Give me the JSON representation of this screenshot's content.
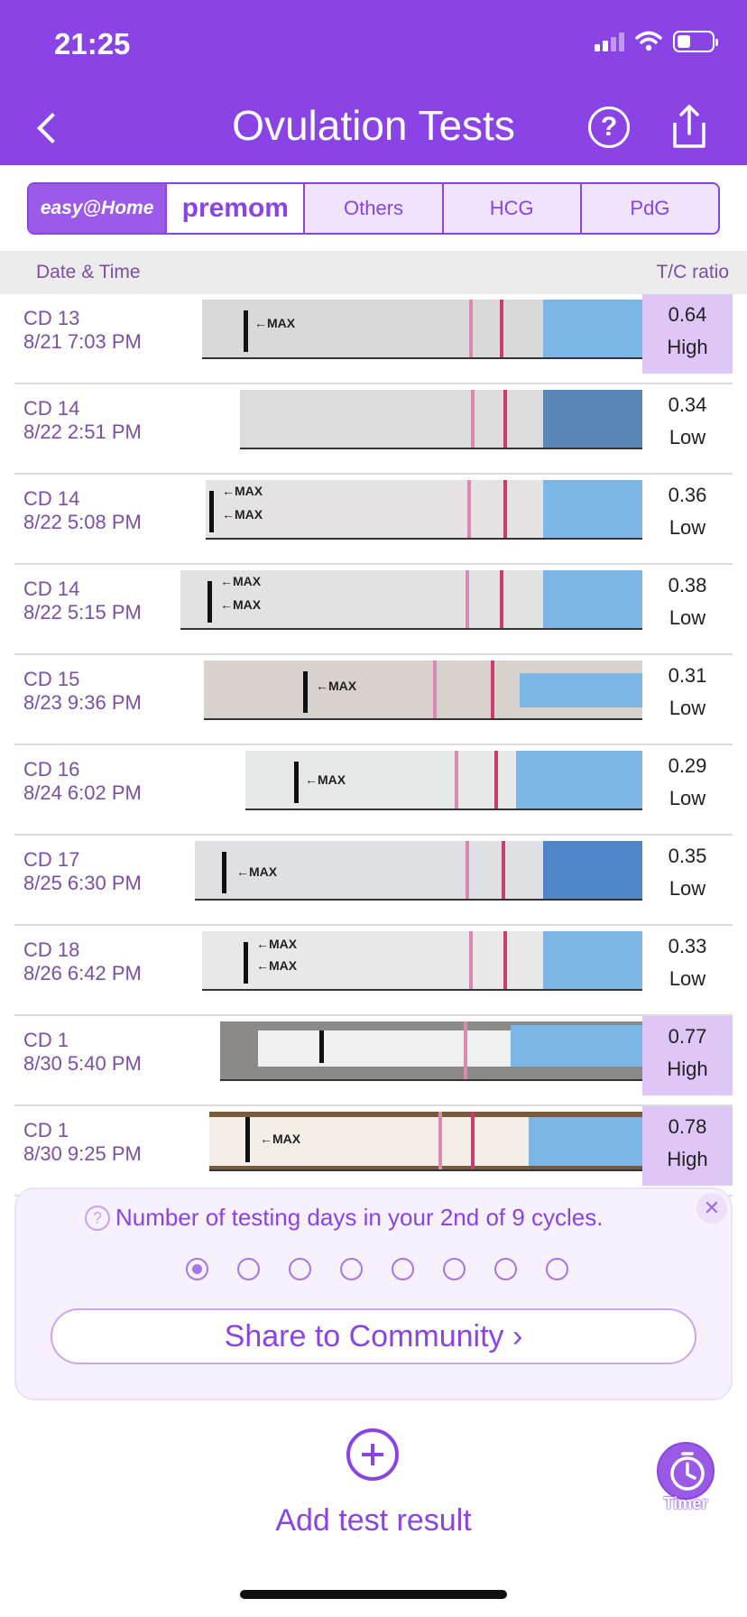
{
  "status_bar": {
    "time": "21:25"
  },
  "header": {
    "title": "Ovulation Tests"
  },
  "brand_tabs": [
    {
      "label": "easy@Home"
    },
    {
      "label": "premom"
    },
    {
      "label": "Others"
    },
    {
      "label": "HCG"
    },
    {
      "label": "PdG"
    }
  ],
  "table": {
    "col_date": "Date & Time",
    "col_ratio": "T/C ratio",
    "rows": [
      {
        "cd": "CD 13",
        "datetime": "8/21 7:03 PM",
        "ratio": "0.64",
        "level": "High"
      },
      {
        "cd": "CD 14",
        "datetime": "8/22 2:51 PM",
        "ratio": "0.34",
        "level": "Low"
      },
      {
        "cd": "CD 14",
        "datetime": "8/22 5:08 PM",
        "ratio": "0.36",
        "level": "Low"
      },
      {
        "cd": "CD 14",
        "datetime": "8/22 5:15 PM",
        "ratio": "0.38",
        "level": "Low"
      },
      {
        "cd": "CD 15",
        "datetime": "8/23 9:36 PM",
        "ratio": "0.31",
        "level": "Low"
      },
      {
        "cd": "CD 16",
        "datetime": "8/24 6:02 PM",
        "ratio": "0.29",
        "level": "Low"
      },
      {
        "cd": "CD 17",
        "datetime": "8/25 6:30 PM",
        "ratio": "0.35",
        "level": "Low"
      },
      {
        "cd": "CD 18",
        "datetime": "8/26 6:42 PM",
        "ratio": "0.33",
        "level": "Low"
      },
      {
        "cd": "CD 1",
        "datetime": "8/30 5:40 PM",
        "ratio": "0.77",
        "level": "High"
      },
      {
        "cd": "CD 1",
        "datetime": "8/30 9:25 PM",
        "ratio": "0.78",
        "level": "High"
      }
    ]
  },
  "cycle_card": {
    "text": "Number of testing days in your 2nd of 9 cycles.",
    "active_dot": 1,
    "share_label": "Share to Community ›"
  },
  "add_test": {
    "label": "Add test result"
  },
  "timer": {
    "label": "Timer"
  },
  "strip_text": {
    "max": "←MAX"
  },
  "colors": {
    "accent": "#8a44e6",
    "high_bg": "#dec7f7"
  }
}
